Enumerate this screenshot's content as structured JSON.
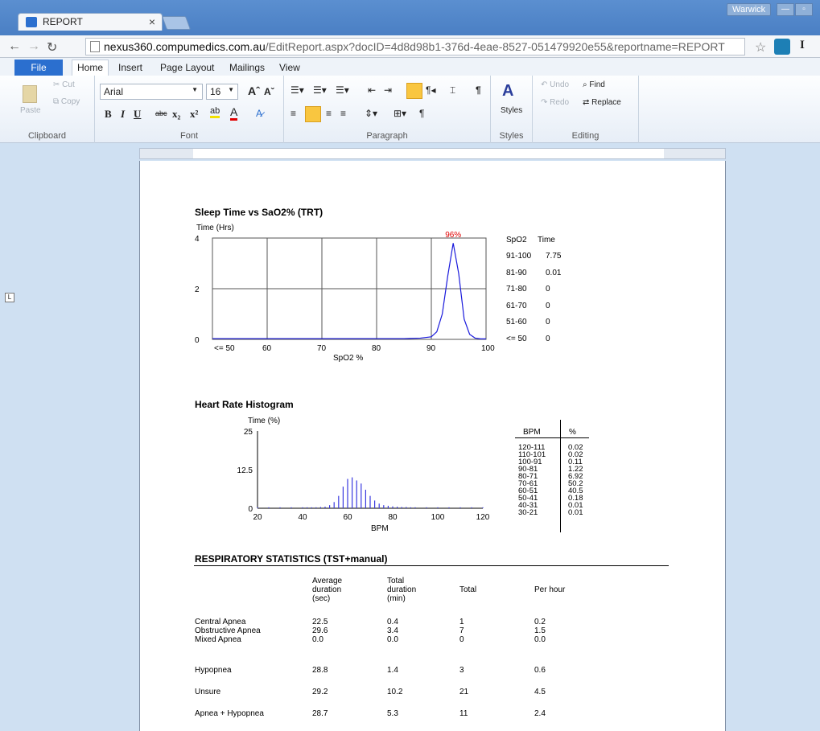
{
  "browser": {
    "tab_title": "REPORT",
    "tab_close": "×",
    "user": "Warwick",
    "url_host": "nexus360.compumedics.com.au",
    "url_path": "/EditReport.aspx?docID=4d8d98b1-376d-4eae-8527-051479920e55&reportname=REPORT",
    "ext_letter": "I"
  },
  "ribbon": {
    "tabs": [
      "File",
      "Home",
      "Insert",
      "Page Layout",
      "Mailings",
      "View"
    ],
    "clipboard": {
      "paste": "Paste",
      "cut": "Cut",
      "copy": "Copy",
      "label": "Clipboard"
    },
    "font": {
      "name": "Arial",
      "size": "16",
      "label": "Font"
    },
    "paragraph": {
      "label": "Paragraph"
    },
    "styles": {
      "button": "Styles",
      "label": "Styles"
    },
    "editing": {
      "undo": "Undo",
      "redo": "Redo",
      "find": "Find",
      "replace": "Replace",
      "label": "Editing"
    }
  },
  "chart1": {
    "title": "Sleep Time vs SaO2% (TRT)",
    "ylabel": "Time (Hrs)",
    "xlabel": "SpO2 %",
    "peak_label": "96%",
    "yticks": [
      "4",
      "2",
      "0"
    ],
    "xticks": [
      "<= 50",
      "60",
      "70",
      "80",
      "90",
      "100"
    ],
    "table_header": [
      "SpO2",
      "Time"
    ],
    "rows": [
      [
        "91-100",
        "7.75"
      ],
      [
        "81-90",
        "0.01"
      ],
      [
        "71-80",
        "0"
      ],
      [
        "61-70",
        "0"
      ],
      [
        "51-60",
        "0"
      ],
      [
        "<= 50",
        "0"
      ]
    ]
  },
  "chart_data": [
    {
      "type": "line",
      "title": "Sleep Time vs SaO2% (TRT)",
      "xlabel": "SpO2 %",
      "ylabel": "Time (Hrs)",
      "xlim": [
        50,
        100
      ],
      "ylim": [
        0,
        4
      ],
      "grid": true,
      "x": [
        50,
        60,
        70,
        80,
        85,
        88,
        90,
        91,
        92,
        93,
        94,
        95,
        96,
        97,
        98,
        99,
        100
      ],
      "y": [
        0.03,
        0.03,
        0.03,
        0.03,
        0.03,
        0.05,
        0.1,
        0.3,
        1.0,
        2.5,
        3.8,
        2.6,
        0.8,
        0.2,
        0.05,
        0.02,
        0.02
      ]
    },
    {
      "type": "bar",
      "title": "Heart Rate Histogram",
      "xlabel": "BPM",
      "ylabel": "Time (%)",
      "xlim": [
        20,
        120
      ],
      "ylim": [
        0,
        25
      ],
      "x": [
        20,
        25,
        30,
        35,
        40,
        42,
        44,
        46,
        48,
        50,
        52,
        54,
        56,
        58,
        60,
        62,
        64,
        66,
        68,
        70,
        72,
        74,
        76,
        78,
        80,
        82,
        84,
        86,
        88,
        90,
        95,
        100,
        105,
        110,
        115,
        120
      ],
      "y": [
        0.3,
        0.3,
        0.3,
        0.3,
        0.3,
        0.3,
        0.3,
        0.3,
        0.4,
        0.5,
        1,
        2,
        4,
        7,
        9.5,
        10,
        9,
        8,
        6,
        4,
        2.5,
        1.5,
        1,
        0.8,
        0.6,
        0.5,
        0.4,
        0.4,
        0.3,
        0.3,
        0.3,
        0.3,
        0.3,
        0.3,
        0.3,
        0.3
      ]
    }
  ],
  "chart2": {
    "title": "Heart Rate Histogram",
    "ylabel": "Time (%)",
    "xlabel": "BPM",
    "yticks": [
      "25",
      "12.5",
      "0"
    ],
    "xticks": [
      "20",
      "40",
      "60",
      "80",
      "100",
      "120"
    ],
    "table_header": [
      "BPM",
      "%"
    ],
    "bpm": [
      "120-111",
      "110-101",
      "100-91",
      "90-81",
      "80-71",
      "70-61",
      "60-51",
      "50-41",
      "40-31",
      "30-21"
    ],
    "pct": [
      "0.02",
      "0.02",
      "0.11",
      "1.22",
      "6.92",
      "50.2",
      "40.5",
      "0.18",
      "0.01",
      "0.01"
    ]
  },
  "resp": {
    "title": "RESPIRATORY STATISTICS (TST+manual)",
    "headers": [
      "Average duration (sec)",
      "Total duration (min)",
      "Total",
      "Per hour"
    ],
    "h1": [
      "Average",
      "duration",
      "(sec)"
    ],
    "h2": [
      "Total",
      "duration",
      "(min)"
    ],
    "h3": "Total",
    "h4": "Per hour",
    "rows": [
      {
        "label": "Central Apnea",
        "avg": "22.5",
        "dur": "0.4",
        "total": "1",
        "ph": "0.2"
      },
      {
        "label": "Obstructive Apnea",
        "avg": "29.6",
        "dur": "3.4",
        "total": "7",
        "ph": "1.5"
      },
      {
        "label": "Mixed Apnea",
        "avg": "0.0",
        "dur": "0.0",
        "total": "0",
        "ph": "0.0"
      },
      {
        "label": "Hypopnea",
        "avg": "28.8",
        "dur": "1.4",
        "total": "3",
        "ph": "0.6"
      },
      {
        "label": "Unsure",
        "avg": "29.2",
        "dur": "10.2",
        "total": "21",
        "ph": "4.5"
      },
      {
        "label": "Apnea + Hypopnea",
        "avg": "28.7",
        "dur": "5.3",
        "total": "11",
        "ph": "2.4"
      }
    ]
  }
}
